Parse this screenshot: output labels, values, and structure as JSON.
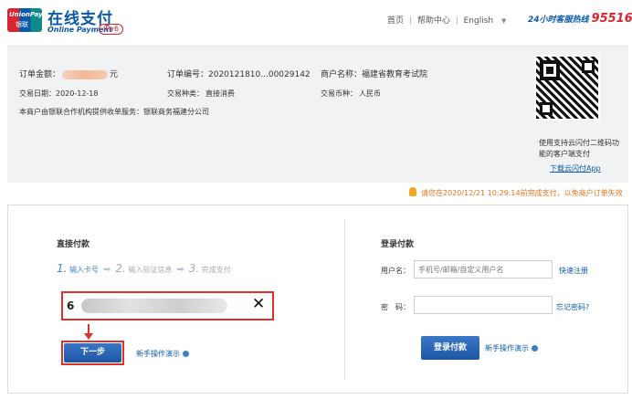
{
  "header": {
    "logo_top": "UnionPay",
    "logo_bottom": "银联",
    "title": "在线支付",
    "subtitle": "Online Payment",
    "ipv6": "IPv6",
    "nav": [
      "首页",
      "帮助中心",
      "English"
    ],
    "hotline_label": "24小时客服热线",
    "hotline_number": "95516"
  },
  "order": {
    "amount_label": "订单金额：",
    "amount_unit": "元",
    "order_no": "订单编号：2020121810...00029142",
    "merchant": "商户名称：福建省教育考试院",
    "trade_date": "交易日期：2020-12-18",
    "trade_type_label": "交易种类：",
    "trade_type": "直接消费",
    "currency_label": "交易币种：",
    "currency": "人民币",
    "service_note": "本商户由银联合作机构提供收单服务：银联商务福建分公司",
    "qr_note": "使用支持云闪付二维码功能的客户端支付",
    "qr_link": "下载云闪付App"
  },
  "warning": "请您在2020/12/21 10:29:14前完成支付，以免商户订单失效",
  "direct": {
    "title": "直接付款",
    "steps": [
      {
        "num": "1.",
        "text": "输入卡号"
      },
      {
        "num": "2.",
        "text": "输入验证信息"
      },
      {
        "num": "3.",
        "text": "完成支付"
      }
    ],
    "card_prefix": "6",
    "clear_icon": "✕",
    "next_button": "下一步",
    "demo_link": "新手操作演示"
  },
  "login": {
    "title": "登录付款",
    "username_label": "用户名：",
    "username_placeholder": "手机号/邮箱/自定义用户名",
    "register_link": "快速注册",
    "password_label": "密　码：",
    "forgot_link": "忘记密码?",
    "login_button": "登录付款",
    "demo_link": "新手操作演示"
  }
}
